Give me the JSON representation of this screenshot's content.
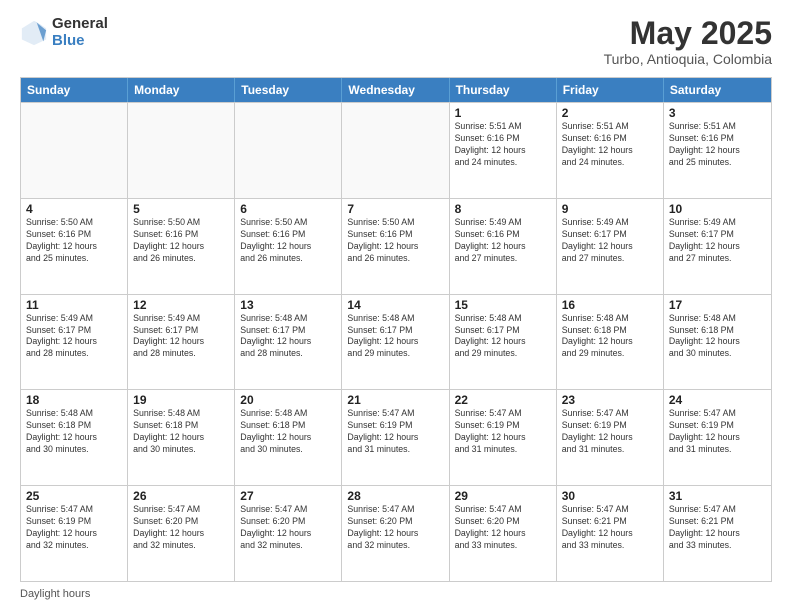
{
  "header": {
    "logo_general": "General",
    "logo_blue": "Blue",
    "title": "May 2025",
    "subtitle": "Turbo, Antioquia, Colombia"
  },
  "days_of_week": [
    "Sunday",
    "Monday",
    "Tuesday",
    "Wednesday",
    "Thursday",
    "Friday",
    "Saturday"
  ],
  "footer": "Daylight hours",
  "weeks": [
    [
      {
        "day": "",
        "info": ""
      },
      {
        "day": "",
        "info": ""
      },
      {
        "day": "",
        "info": ""
      },
      {
        "day": "",
        "info": ""
      },
      {
        "day": "1",
        "info": "Sunrise: 5:51 AM\nSunset: 6:16 PM\nDaylight: 12 hours\nand 24 minutes."
      },
      {
        "day": "2",
        "info": "Sunrise: 5:51 AM\nSunset: 6:16 PM\nDaylight: 12 hours\nand 24 minutes."
      },
      {
        "day": "3",
        "info": "Sunrise: 5:51 AM\nSunset: 6:16 PM\nDaylight: 12 hours\nand 25 minutes."
      }
    ],
    [
      {
        "day": "4",
        "info": "Sunrise: 5:50 AM\nSunset: 6:16 PM\nDaylight: 12 hours\nand 25 minutes."
      },
      {
        "day": "5",
        "info": "Sunrise: 5:50 AM\nSunset: 6:16 PM\nDaylight: 12 hours\nand 26 minutes."
      },
      {
        "day": "6",
        "info": "Sunrise: 5:50 AM\nSunset: 6:16 PM\nDaylight: 12 hours\nand 26 minutes."
      },
      {
        "day": "7",
        "info": "Sunrise: 5:50 AM\nSunset: 6:16 PM\nDaylight: 12 hours\nand 26 minutes."
      },
      {
        "day": "8",
        "info": "Sunrise: 5:49 AM\nSunset: 6:16 PM\nDaylight: 12 hours\nand 27 minutes."
      },
      {
        "day": "9",
        "info": "Sunrise: 5:49 AM\nSunset: 6:17 PM\nDaylight: 12 hours\nand 27 minutes."
      },
      {
        "day": "10",
        "info": "Sunrise: 5:49 AM\nSunset: 6:17 PM\nDaylight: 12 hours\nand 27 minutes."
      }
    ],
    [
      {
        "day": "11",
        "info": "Sunrise: 5:49 AM\nSunset: 6:17 PM\nDaylight: 12 hours\nand 28 minutes."
      },
      {
        "day": "12",
        "info": "Sunrise: 5:49 AM\nSunset: 6:17 PM\nDaylight: 12 hours\nand 28 minutes."
      },
      {
        "day": "13",
        "info": "Sunrise: 5:48 AM\nSunset: 6:17 PM\nDaylight: 12 hours\nand 28 minutes."
      },
      {
        "day": "14",
        "info": "Sunrise: 5:48 AM\nSunset: 6:17 PM\nDaylight: 12 hours\nand 29 minutes."
      },
      {
        "day": "15",
        "info": "Sunrise: 5:48 AM\nSunset: 6:17 PM\nDaylight: 12 hours\nand 29 minutes."
      },
      {
        "day": "16",
        "info": "Sunrise: 5:48 AM\nSunset: 6:18 PM\nDaylight: 12 hours\nand 29 minutes."
      },
      {
        "day": "17",
        "info": "Sunrise: 5:48 AM\nSunset: 6:18 PM\nDaylight: 12 hours\nand 30 minutes."
      }
    ],
    [
      {
        "day": "18",
        "info": "Sunrise: 5:48 AM\nSunset: 6:18 PM\nDaylight: 12 hours\nand 30 minutes."
      },
      {
        "day": "19",
        "info": "Sunrise: 5:48 AM\nSunset: 6:18 PM\nDaylight: 12 hours\nand 30 minutes."
      },
      {
        "day": "20",
        "info": "Sunrise: 5:48 AM\nSunset: 6:18 PM\nDaylight: 12 hours\nand 30 minutes."
      },
      {
        "day": "21",
        "info": "Sunrise: 5:47 AM\nSunset: 6:19 PM\nDaylight: 12 hours\nand 31 minutes."
      },
      {
        "day": "22",
        "info": "Sunrise: 5:47 AM\nSunset: 6:19 PM\nDaylight: 12 hours\nand 31 minutes."
      },
      {
        "day": "23",
        "info": "Sunrise: 5:47 AM\nSunset: 6:19 PM\nDaylight: 12 hours\nand 31 minutes."
      },
      {
        "day": "24",
        "info": "Sunrise: 5:47 AM\nSunset: 6:19 PM\nDaylight: 12 hours\nand 31 minutes."
      }
    ],
    [
      {
        "day": "25",
        "info": "Sunrise: 5:47 AM\nSunset: 6:19 PM\nDaylight: 12 hours\nand 32 minutes."
      },
      {
        "day": "26",
        "info": "Sunrise: 5:47 AM\nSunset: 6:20 PM\nDaylight: 12 hours\nand 32 minutes."
      },
      {
        "day": "27",
        "info": "Sunrise: 5:47 AM\nSunset: 6:20 PM\nDaylight: 12 hours\nand 32 minutes."
      },
      {
        "day": "28",
        "info": "Sunrise: 5:47 AM\nSunset: 6:20 PM\nDaylight: 12 hours\nand 32 minutes."
      },
      {
        "day": "29",
        "info": "Sunrise: 5:47 AM\nSunset: 6:20 PM\nDaylight: 12 hours\nand 33 minutes."
      },
      {
        "day": "30",
        "info": "Sunrise: 5:47 AM\nSunset: 6:21 PM\nDaylight: 12 hours\nand 33 minutes."
      },
      {
        "day": "31",
        "info": "Sunrise: 5:47 AM\nSunset: 6:21 PM\nDaylight: 12 hours\nand 33 minutes."
      }
    ]
  ]
}
